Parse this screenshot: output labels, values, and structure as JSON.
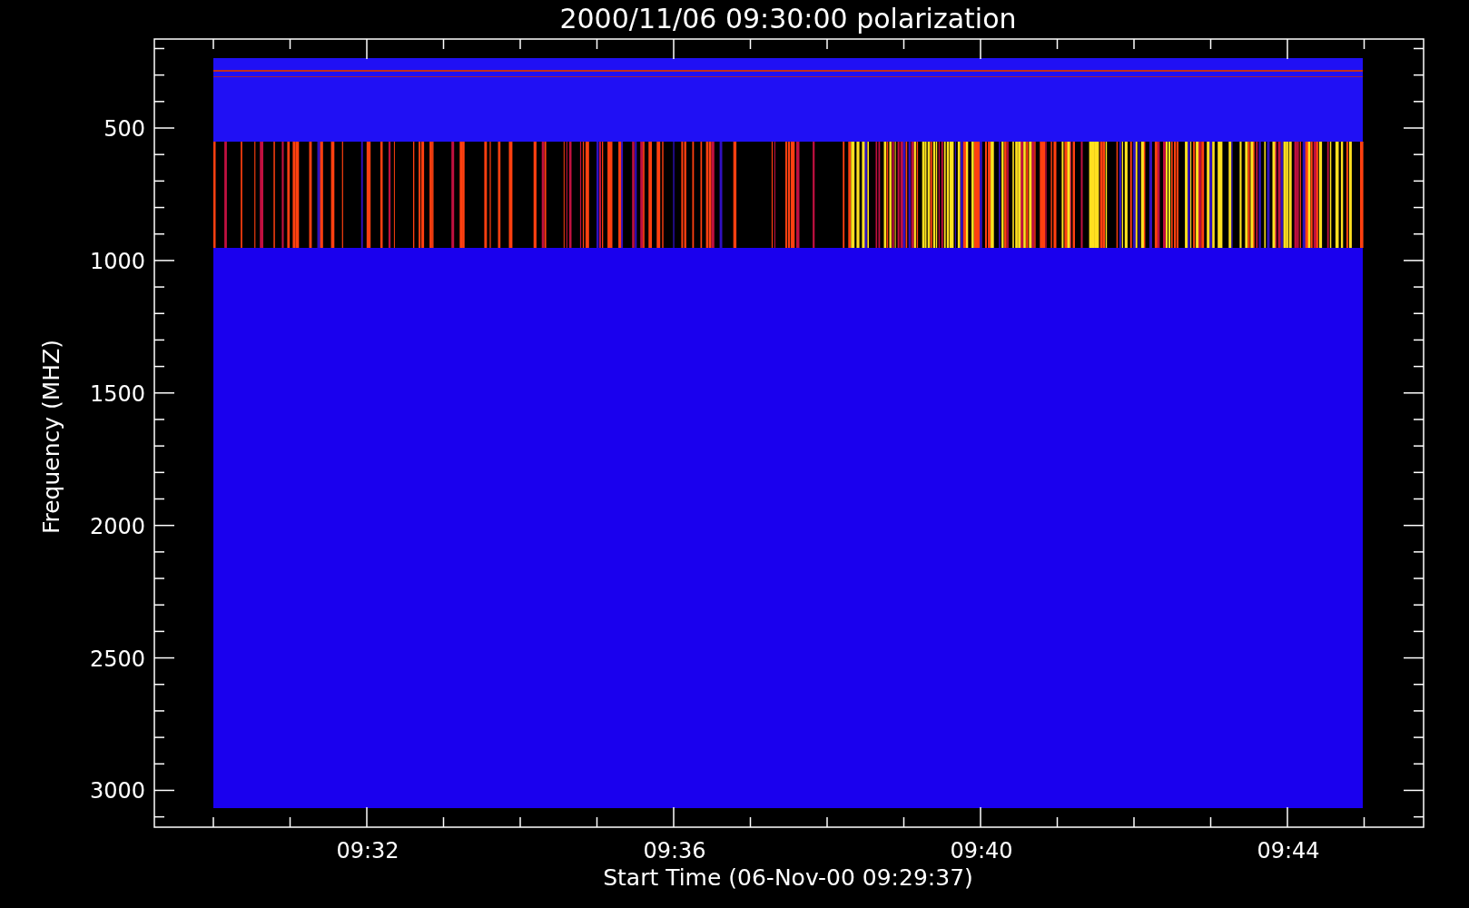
{
  "title": "2000/11/06 09:30:00 polarization",
  "xaxis": {
    "label": "Start Time (06-Nov-00 09:29:37)",
    "ticks": [
      "09:32",
      "09:36",
      "09:40",
      "09:44"
    ]
  },
  "yaxis": {
    "label": "Frequency (MHZ)",
    "ticks": [
      "500",
      "1000",
      "1500",
      "2000",
      "2500",
      "3000"
    ]
  }
}
